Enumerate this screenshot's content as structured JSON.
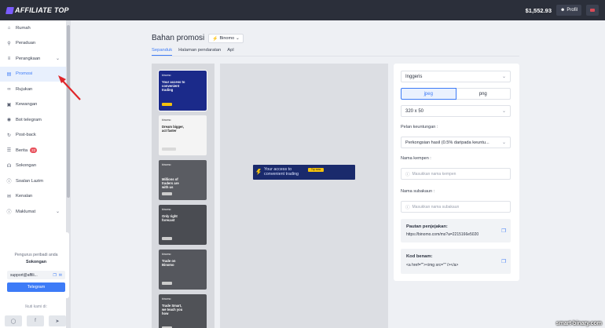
{
  "topbar": {
    "logo_text": "AFFILIATE TOP",
    "balance": "$1,552.93",
    "profile_label": "Profil"
  },
  "sidebar": {
    "items": [
      {
        "label": "Rumah",
        "icon": "home-icon"
      },
      {
        "label": "Peraduan",
        "icon": "trophy-icon"
      },
      {
        "label": "Perangkaan",
        "icon": "chart-icon"
      },
      {
        "label": "Promosi",
        "icon": "image-icon"
      },
      {
        "label": "Rujukan",
        "icon": "link-icon"
      },
      {
        "label": "Kewangan",
        "icon": "wallet-icon"
      },
      {
        "label": "Bot telegram",
        "icon": "bot-icon"
      },
      {
        "label": "Post-back",
        "icon": "refresh-icon"
      },
      {
        "label": "Berita",
        "icon": "news-icon",
        "badge": "22"
      },
      {
        "label": "Sokongan",
        "icon": "headset-icon"
      },
      {
        "label": "Soalan Lazim",
        "icon": "question-icon"
      },
      {
        "label": "Kenalan",
        "icon": "mail-icon"
      },
      {
        "label": "Maklumat",
        "icon": "info-icon"
      }
    ],
    "support": {
      "title": "Pengurus peribadi anda",
      "subtitle": "Sokongan",
      "email": "support@affili...",
      "telegram_label": "Telegram"
    },
    "follow_label": "Ikuti kami di:"
  },
  "main": {
    "title": "Bahan promosi",
    "broker": "Binomo",
    "tabs": [
      "Sepanduk",
      "Halaman pendaratan",
      "Apl"
    ],
    "thumbnails": [
      {
        "tag": "binomo",
        "headline": "Your access to convenient trading",
        "button": "Try now"
      },
      {
        "tag": "binomo",
        "headline": "Dream bigger, act faster",
        "button": "Try it now"
      },
      {
        "tag": "binomo",
        "headline": "Millions of traders are with us",
        "button": "Join now"
      },
      {
        "tag": "binomo",
        "headline": "Only right forecast",
        "button": "Trade now"
      },
      {
        "tag": "binomo",
        "headline": "Trade on Binomo",
        "button": "Trade now"
      },
      {
        "tag": "binomo",
        "headline": "Trade Smart, we teach you how",
        "button": "Join now"
      }
    ],
    "preview_banner": {
      "headline": "Your access to convenient trading",
      "button": "Try now"
    }
  },
  "settings": {
    "language": "Inggeris",
    "format_options": [
      "jpeg",
      "png"
    ],
    "size": "320 x 50",
    "profit_label": "Pelan keuntungan :",
    "profit_value": "Perkongsian hasil (0.5% daripada keuntu...",
    "campaign_label": "Nama kempen :",
    "campaign_placeholder": "Masukkan nama kempen",
    "subaccount_label": "Nama subakaun :",
    "subaccount_placeholder": "Masukkan nama subakaun",
    "tracking_label": "Pautan penjejakan:",
    "tracking_url": "https://binomo.com/ms?a=2215166e5020",
    "code_label": "Kod benam:",
    "code_value": "<a href=\"\"><img src=\"\" /></a>"
  },
  "watermark": "smart-binary.com"
}
